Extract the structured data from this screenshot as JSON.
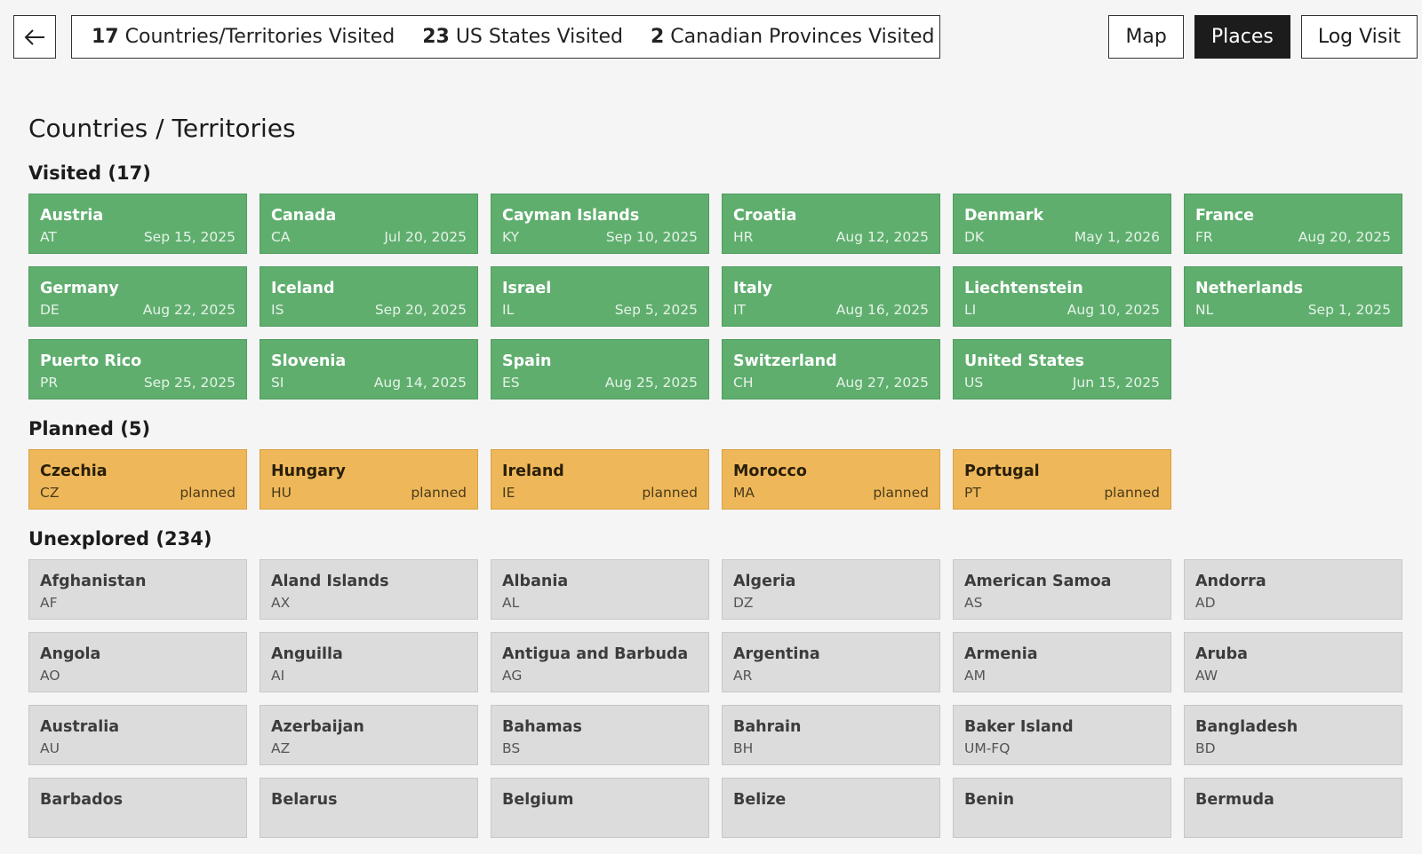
{
  "header": {
    "back_label": "back",
    "stats": [
      {
        "count": "17",
        "label": "Countries/Territories Visited"
      },
      {
        "count": "23",
        "label": "US States Visited"
      },
      {
        "count": "2",
        "label": "Canadian Provinces Visited"
      }
    ],
    "nav": [
      {
        "label": "Map",
        "active": false
      },
      {
        "label": "Places",
        "active": true
      },
      {
        "label": "Log Visit",
        "active": false
      }
    ]
  },
  "page_title": "Countries / Territories",
  "sections": [
    {
      "key": "visited",
      "title": "Visited (17)",
      "items": [
        {
          "name": "Austria",
          "code": "AT",
          "meta": "Sep 15, 2025"
        },
        {
          "name": "Canada",
          "code": "CA",
          "meta": "Jul 20, 2025"
        },
        {
          "name": "Cayman Islands",
          "code": "KY",
          "meta": "Sep 10, 2025"
        },
        {
          "name": "Croatia",
          "code": "HR",
          "meta": "Aug 12, 2025"
        },
        {
          "name": "Denmark",
          "code": "DK",
          "meta": "May 1, 2026"
        },
        {
          "name": "France",
          "code": "FR",
          "meta": "Aug 20, 2025"
        },
        {
          "name": "Germany",
          "code": "DE",
          "meta": "Aug 22, 2025"
        },
        {
          "name": "Iceland",
          "code": "IS",
          "meta": "Sep 20, 2025"
        },
        {
          "name": "Israel",
          "code": "IL",
          "meta": "Sep 5, 2025"
        },
        {
          "name": "Italy",
          "code": "IT",
          "meta": "Aug 16, 2025"
        },
        {
          "name": "Liechtenstein",
          "code": "LI",
          "meta": "Aug 10, 2025"
        },
        {
          "name": "Netherlands",
          "code": "NL",
          "meta": "Sep 1, 2025"
        },
        {
          "name": "Puerto Rico",
          "code": "PR",
          "meta": "Sep 25, 2025"
        },
        {
          "name": "Slovenia",
          "code": "SI",
          "meta": "Aug 14, 2025"
        },
        {
          "name": "Spain",
          "code": "ES",
          "meta": "Aug 25, 2025"
        },
        {
          "name": "Switzerland",
          "code": "CH",
          "meta": "Aug 27, 2025"
        },
        {
          "name": "United States",
          "code": "US",
          "meta": "Jun 15, 2025"
        }
      ]
    },
    {
      "key": "planned",
      "title": "Planned (5)",
      "items": [
        {
          "name": "Czechia",
          "code": "CZ",
          "meta": "planned"
        },
        {
          "name": "Hungary",
          "code": "HU",
          "meta": "planned"
        },
        {
          "name": "Ireland",
          "code": "IE",
          "meta": "planned"
        },
        {
          "name": "Morocco",
          "code": "MA",
          "meta": "planned"
        },
        {
          "name": "Portugal",
          "code": "PT",
          "meta": "planned"
        }
      ]
    },
    {
      "key": "unexplored",
      "title": "Unexplored (234)",
      "items": [
        {
          "name": "Afghanistan",
          "code": "AF",
          "meta": ""
        },
        {
          "name": "Aland Islands",
          "code": "AX",
          "meta": ""
        },
        {
          "name": "Albania",
          "code": "AL",
          "meta": ""
        },
        {
          "name": "Algeria",
          "code": "DZ",
          "meta": ""
        },
        {
          "name": "American Samoa",
          "code": "AS",
          "meta": ""
        },
        {
          "name": "Andorra",
          "code": "AD",
          "meta": ""
        },
        {
          "name": "Angola",
          "code": "AO",
          "meta": ""
        },
        {
          "name": "Anguilla",
          "code": "AI",
          "meta": ""
        },
        {
          "name": "Antigua and Barbuda",
          "code": "AG",
          "meta": ""
        },
        {
          "name": "Argentina",
          "code": "AR",
          "meta": ""
        },
        {
          "name": "Armenia",
          "code": "AM",
          "meta": ""
        },
        {
          "name": "Aruba",
          "code": "AW",
          "meta": ""
        },
        {
          "name": "Australia",
          "code": "AU",
          "meta": ""
        },
        {
          "name": "Azerbaijan",
          "code": "AZ",
          "meta": ""
        },
        {
          "name": "Bahamas",
          "code": "BS",
          "meta": ""
        },
        {
          "name": "Bahrain",
          "code": "BH",
          "meta": ""
        },
        {
          "name": "Baker Island",
          "code": "UM-FQ",
          "meta": ""
        },
        {
          "name": "Bangladesh",
          "code": "BD",
          "meta": ""
        },
        {
          "name": "Barbados",
          "code": "",
          "meta": ""
        },
        {
          "name": "Belarus",
          "code": "",
          "meta": ""
        },
        {
          "name": "Belgium",
          "code": "",
          "meta": ""
        },
        {
          "name": "Belize",
          "code": "",
          "meta": ""
        },
        {
          "name": "Benin",
          "code": "",
          "meta": ""
        },
        {
          "name": "Bermuda",
          "code": "",
          "meta": ""
        }
      ]
    }
  ]
}
